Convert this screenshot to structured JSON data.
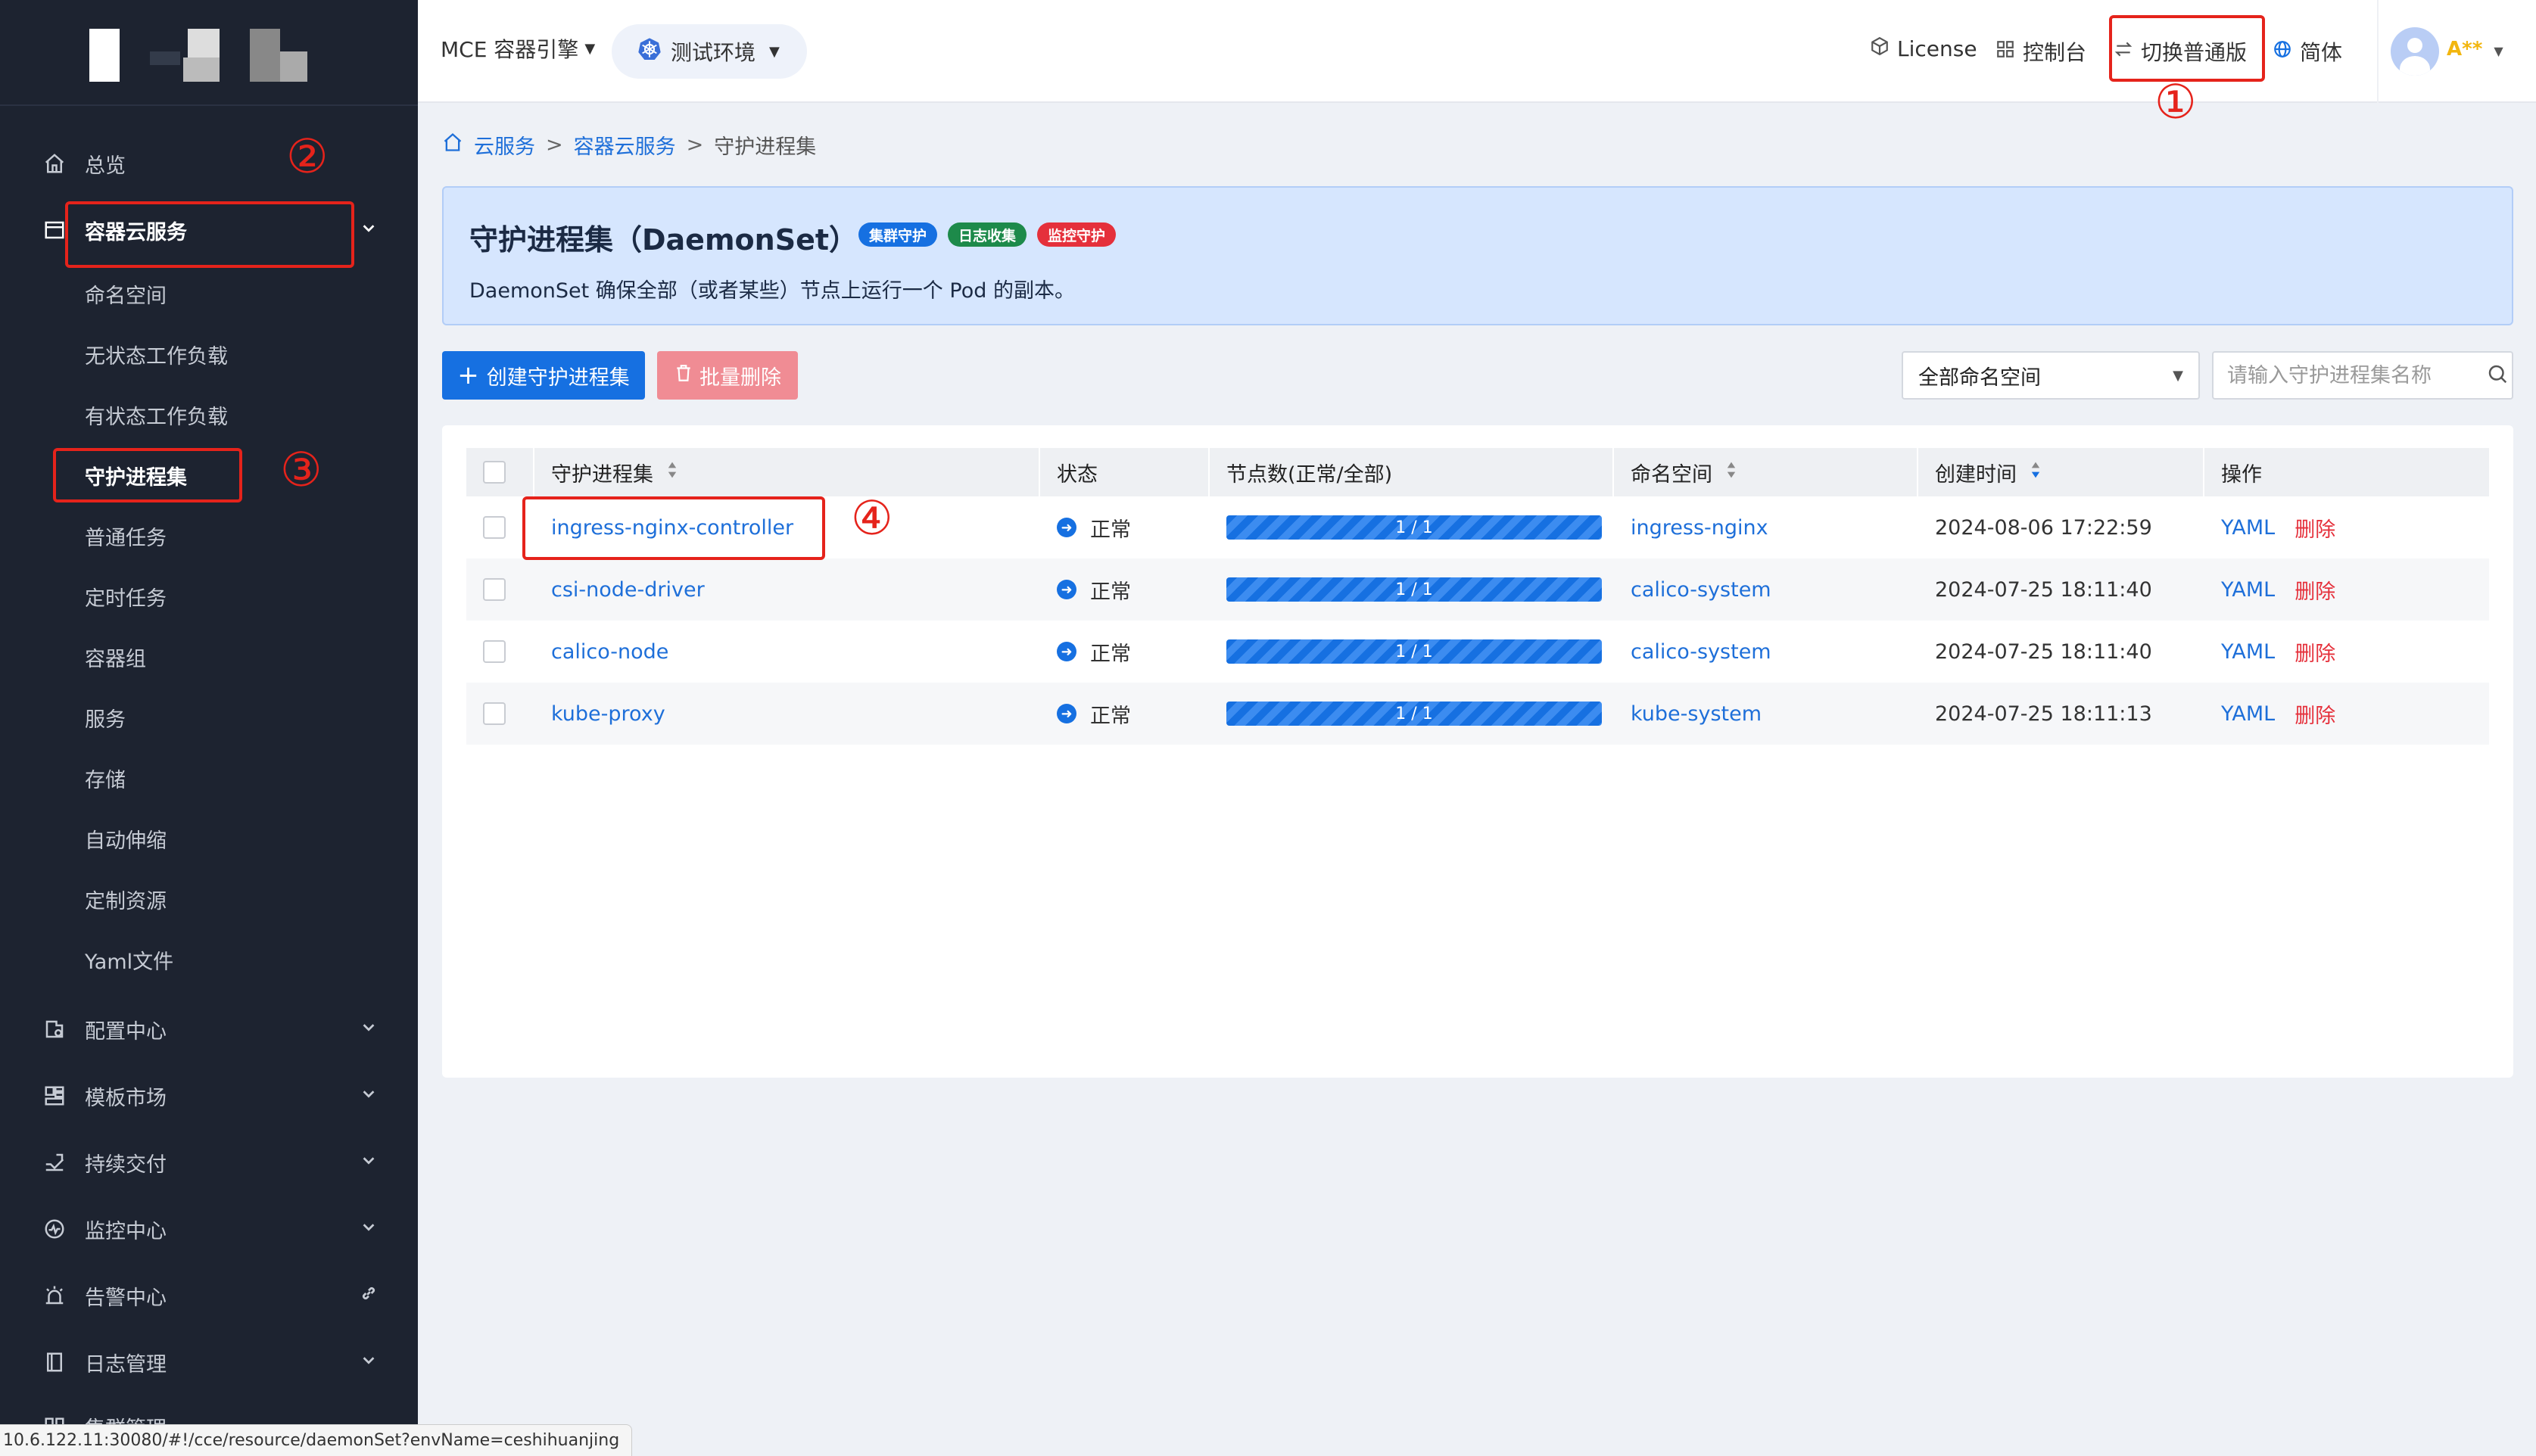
{
  "sidebar": {
    "items": [
      {
        "label": "总览",
        "icon": "home-icon"
      },
      {
        "label": "容器云服务",
        "icon": "container-icon"
      },
      {
        "label": "配置中心",
        "icon": "config-icon"
      },
      {
        "label": "模板市场",
        "icon": "template-icon"
      },
      {
        "label": "持续交付",
        "icon": "delivery-icon"
      },
      {
        "label": "监控中心",
        "icon": "monitor-icon"
      },
      {
        "label": "告警中心",
        "icon": "alarm-icon"
      },
      {
        "label": "日志管理",
        "icon": "log-icon"
      },
      {
        "label": "集群管理",
        "icon": "cluster-icon"
      }
    ],
    "sub_items": [
      "命名空间",
      "无状态工作负载",
      "有状态工作负载",
      "守护进程集",
      "普通任务",
      "定时任务",
      "容器组",
      "服务",
      "存储",
      "自动伸缩",
      "定制资源",
      "Yaml文件"
    ],
    "active_sub": "守护进程集"
  },
  "status_url": "10.6.122.11:30080/#!/cce/resource/daemonSet?envName=ceshihuanjing",
  "header": {
    "engine": "MCE 容器引擎",
    "env": "测试环境",
    "license": "License",
    "console": "控制台",
    "switch": "切换普通版",
    "lang": "简体",
    "user": "A**"
  },
  "breadcrumb": [
    "云服务",
    "容器云服务",
    "守护进程集"
  ],
  "panel": {
    "title": "守护进程集（DaemonSet）",
    "badges": [
      {
        "label": "集群守护",
        "color": "#1670e1"
      },
      {
        "label": "日志收集",
        "color": "#1d8a4a"
      },
      {
        "label": "监控守护",
        "color": "#e5303b"
      }
    ],
    "desc": "DaemonSet 确保全部（或者某些）节点上运行一个 Pod 的副本。"
  },
  "toolbar": {
    "create_label": "创建守护进程集",
    "batch_delete_label": "批量删除",
    "ns_select": "全部命名空间",
    "search_placeholder": "请输入守护进程集名称"
  },
  "table": {
    "headers": [
      "守护进程集",
      "状态",
      "节点数(正常/全部)",
      "命名空间",
      "创建时间",
      "操作"
    ],
    "rows": [
      {
        "name": "ingress-nginx-controller",
        "status": "正常",
        "ready": 1,
        "total": 1,
        "nodes": "1 / 1",
        "ns": "ingress-nginx",
        "created": "2024-08-06 17:22:59",
        "yaml": "YAML",
        "del": "删除"
      },
      {
        "name": "csi-node-driver",
        "status": "正常",
        "ready": 1,
        "total": 1,
        "nodes": "1 / 1",
        "ns": "calico-system",
        "created": "2024-07-25 18:11:40",
        "yaml": "YAML",
        "del": "删除"
      },
      {
        "name": "calico-node",
        "status": "正常",
        "ready": 1,
        "total": 1,
        "nodes": "1 / 1",
        "ns": "calico-system",
        "created": "2024-07-25 18:11:40",
        "yaml": "YAML",
        "del": "删除"
      },
      {
        "name": "kube-proxy",
        "status": "正常",
        "ready": 1,
        "total": 1,
        "nodes": "1 / 1",
        "ns": "kube-system",
        "created": "2024-07-25 18:11:13",
        "yaml": "YAML",
        "del": "删除"
      }
    ]
  },
  "annotations": [
    "①",
    "②",
    "③",
    "④"
  ],
  "colors": {
    "accent": "#1670e1",
    "danger": "#e5303b",
    "sidebar": "#1d2330",
    "annotation": "#e5231b"
  }
}
